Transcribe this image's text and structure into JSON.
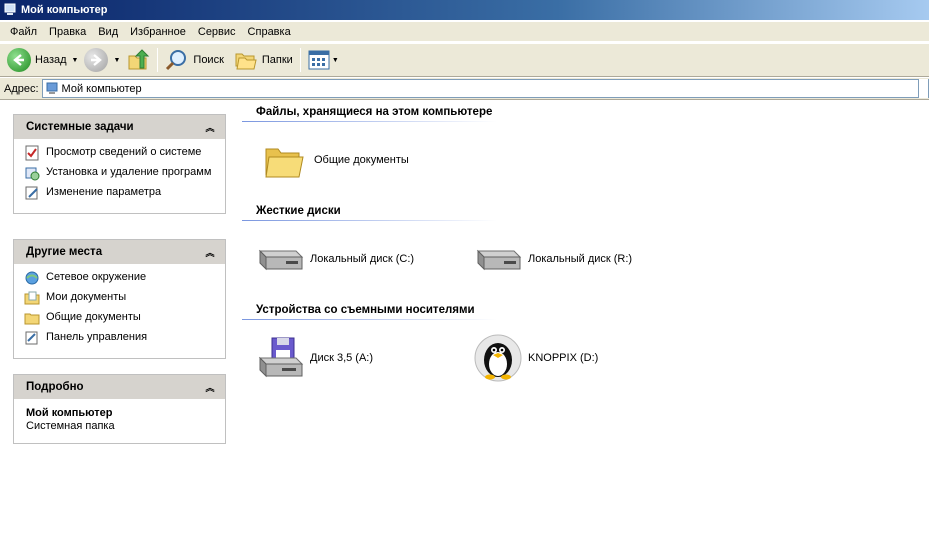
{
  "window": {
    "title": "Мой компьютер"
  },
  "menu": {
    "items": [
      "Файл",
      "Правка",
      "Вид",
      "Избранное",
      "Сервис",
      "Справка"
    ]
  },
  "toolbar": {
    "back_label": "Назад",
    "search_label": "Поиск",
    "folders_label": "Папки"
  },
  "address": {
    "label": "Адрес:",
    "value": "Мой компьютер"
  },
  "left": {
    "system_tasks": {
      "title": "Системные задачи",
      "items": [
        "Просмотр сведений о системе",
        "Установка и удаление программ",
        "Изменение параметра"
      ]
    },
    "other_places": {
      "title": "Другие места",
      "items": [
        "Сетевое окружение",
        "Мои документы",
        "Общие документы",
        "Панель управления"
      ]
    },
    "details": {
      "title": "Подробно",
      "name": "Мой компьютер",
      "type": "Системная папка"
    }
  },
  "main": {
    "groups": [
      {
        "title": "Файлы, хранящиеся на этом компьютере",
        "items": [
          "Общие документы"
        ]
      },
      {
        "title": "Жесткие диски",
        "items": [
          "Локальный диск (C:)",
          "Локальный диск (R:)"
        ]
      },
      {
        "title": "Устройства со съемными носителями",
        "items": [
          "Диск 3,5 (A:)",
          "KNOPPIX (D:)"
        ]
      }
    ]
  },
  "colors": {
    "title_bar": "#0a246a",
    "panel_header": "#d6d3ce",
    "group_line": "#7a96df"
  }
}
